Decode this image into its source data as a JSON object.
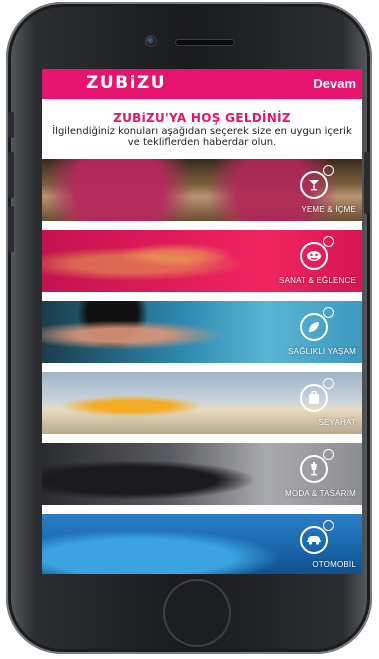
{
  "app": {
    "brand": "ZUBiZU",
    "continue_label": "Devam"
  },
  "intro": {
    "title": "ZUBiZU'YA HOŞ GELDİNİZ",
    "subtitle": "İlgilendiğiniz konuları aşağıdan seçerek size en uygun içerik ve tekliflerden haberdar olun."
  },
  "categories": [
    {
      "label": "YEME & İÇME",
      "icon": "cocktail-icon"
    },
    {
      "label": "SANAT & EĞLENCE",
      "icon": "theater-masks-icon"
    },
    {
      "label": "SAĞLIKLI YAŞAM",
      "icon": "leaf-icon"
    },
    {
      "label": "SEYAHAT",
      "icon": "suitcase-icon"
    },
    {
      "label": "MODA & TASARIM",
      "icon": "mannequin-icon"
    },
    {
      "label": "OTOMOBİL",
      "icon": "car-icon"
    }
  ],
  "colors": {
    "accent": "#e6136f"
  }
}
